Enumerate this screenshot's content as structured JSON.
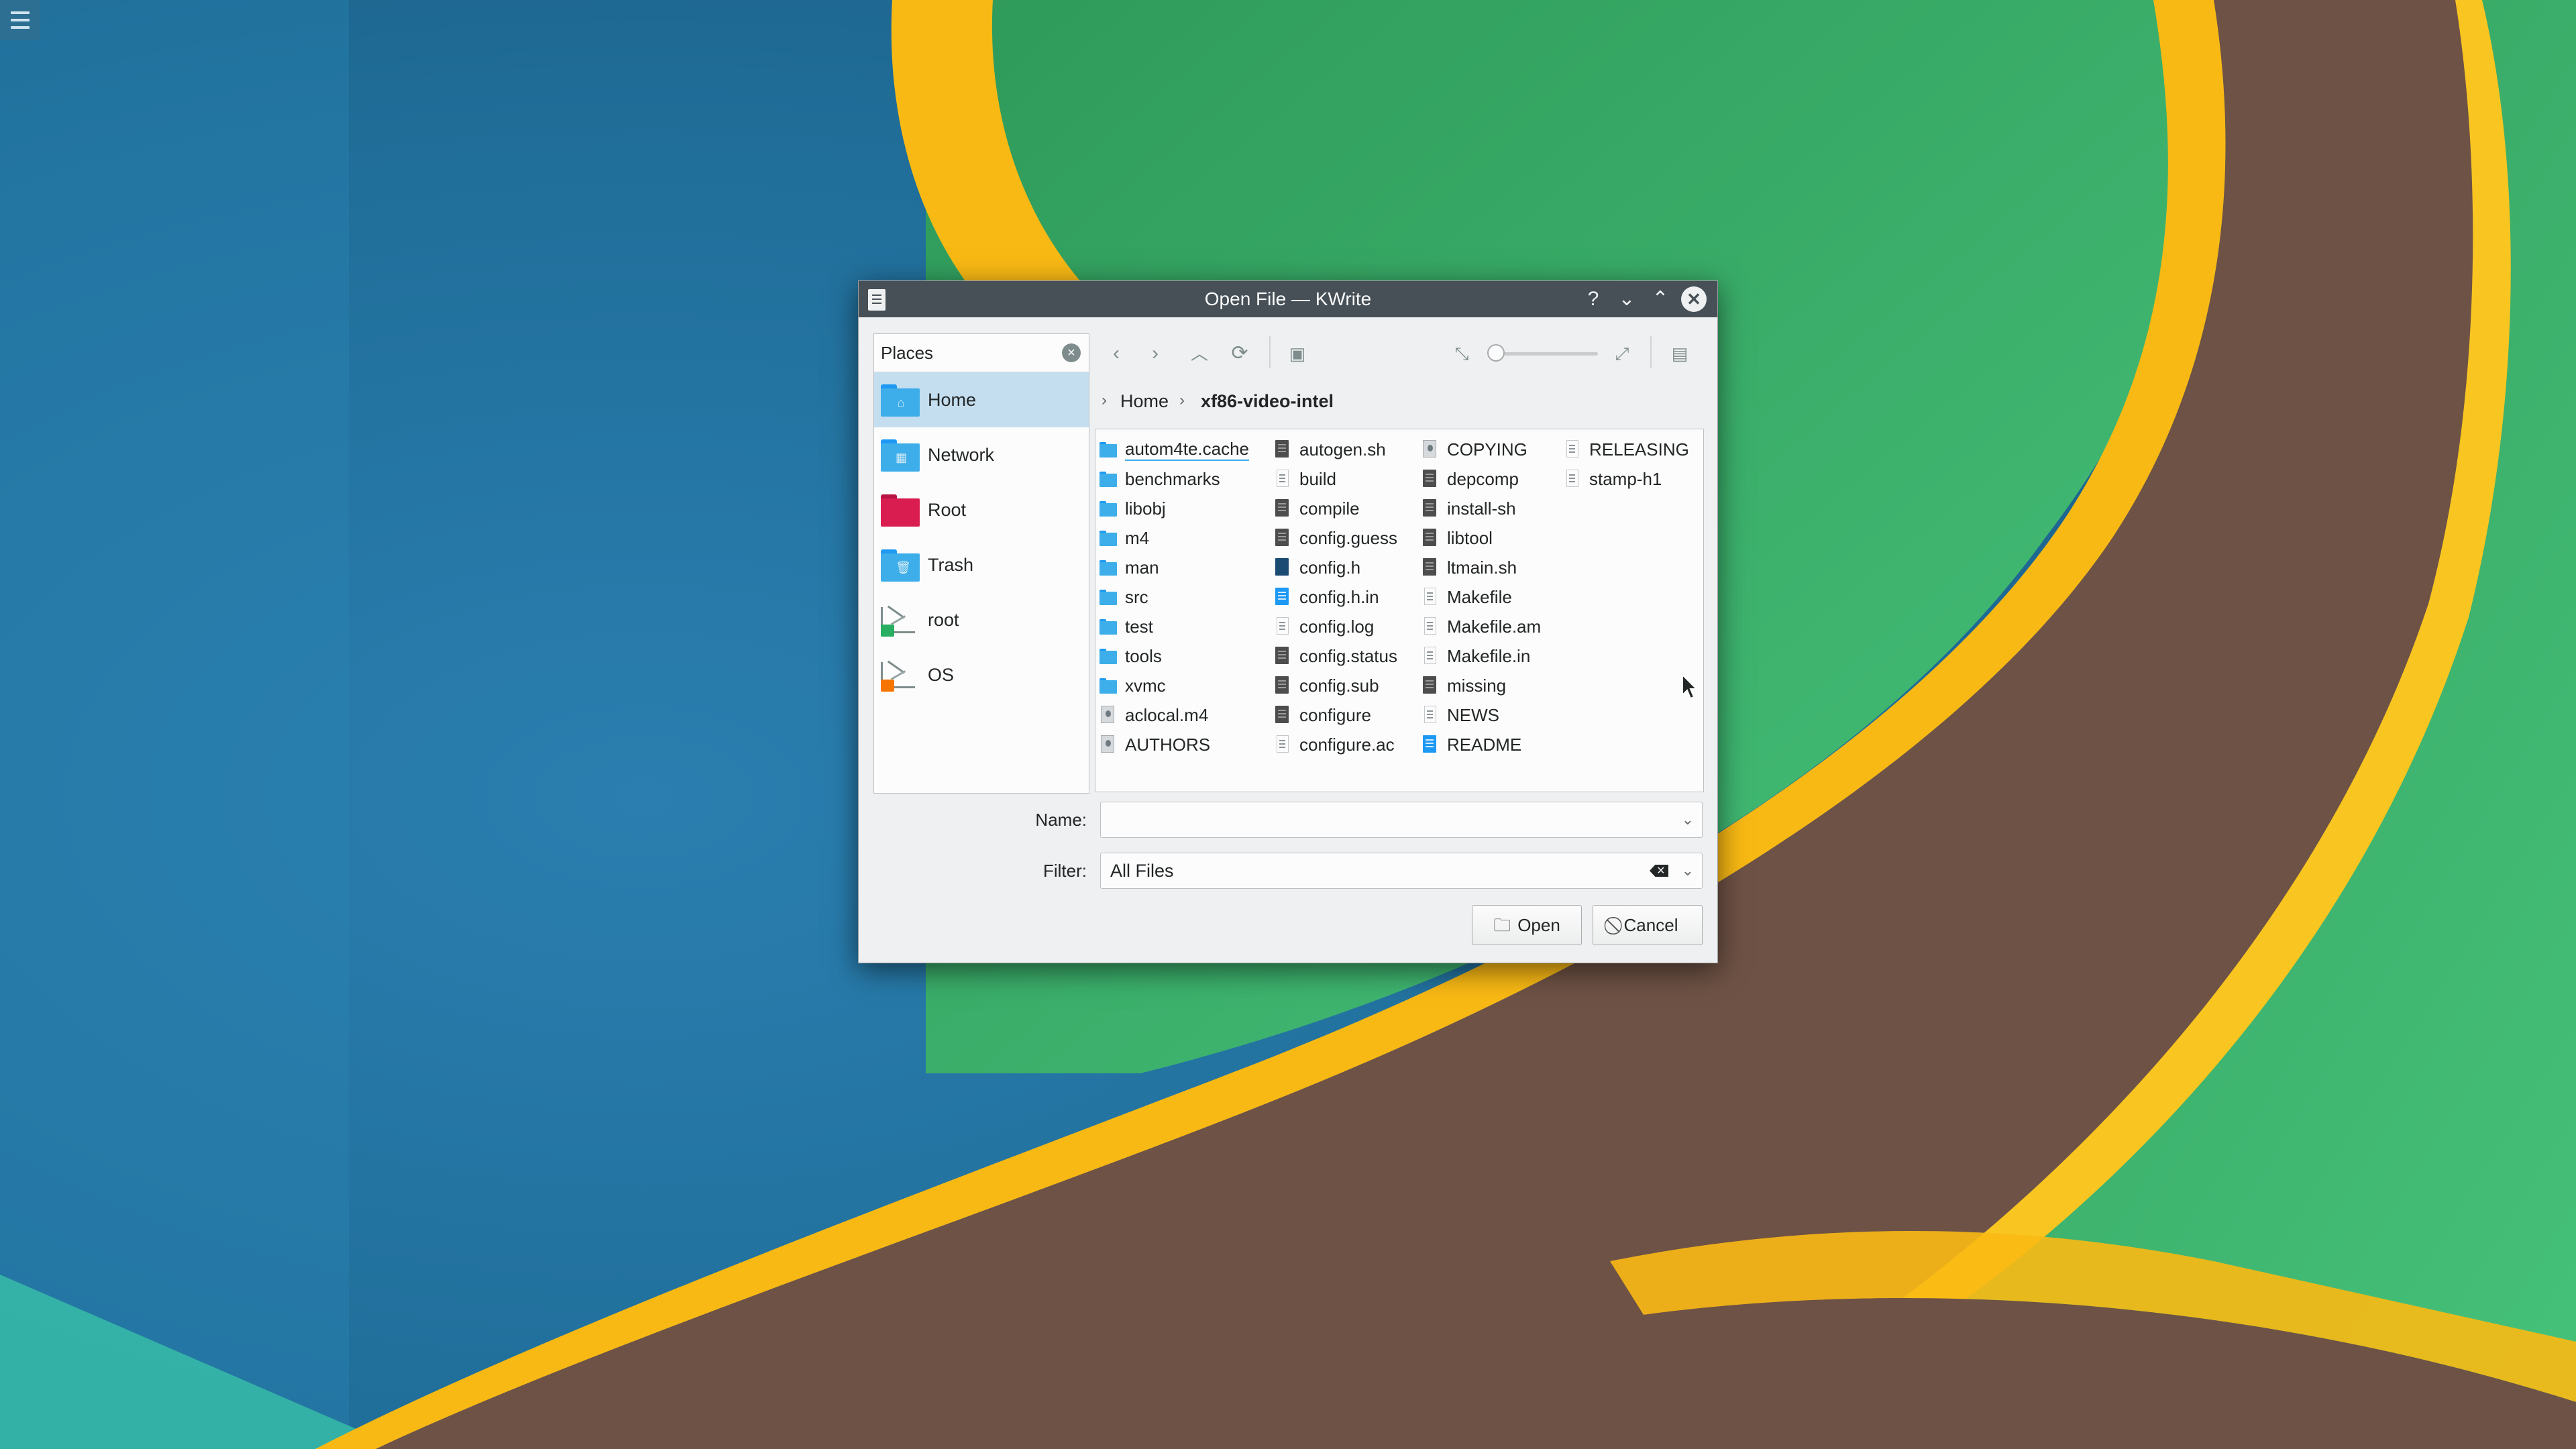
{
  "window": {
    "title": "Open File — KWrite",
    "help": "?",
    "minimize": "⌄",
    "maximize": "⌃",
    "close": "✕"
  },
  "places": {
    "header": "Places",
    "items": [
      {
        "label": "Home",
        "icon": "home-folder-icon",
        "color": "#3daee9",
        "selected": true
      },
      {
        "label": "Network",
        "icon": "network-folder-icon",
        "color": "#3daee9",
        "selected": false
      },
      {
        "label": "Root",
        "icon": "root-folder-icon",
        "color": "#da1d50",
        "selected": false
      },
      {
        "label": "Trash",
        "icon": "trash-folder-icon",
        "color": "#3daee9",
        "selected": false
      },
      {
        "label": "root",
        "icon": "drive-icon",
        "badge_color": "#27ae60",
        "selected": false
      },
      {
        "label": "OS",
        "icon": "drive-icon",
        "badge_color": "#f67400",
        "selected": false
      }
    ]
  },
  "toolbar": {
    "back": "back-arrow-icon",
    "forward": "forward-arrow-icon",
    "up": "up-arrow-icon",
    "reload": "reload-icon",
    "preview": "image-preview-icon",
    "zoom_out": "zoom-out-icon",
    "zoom_in": "zoom-in-icon",
    "zoom_level": 0,
    "options": "panel-options-icon"
  },
  "breadcrumb": {
    "parent": "Home",
    "current": "xf86-video-intel"
  },
  "files": {
    "columns": [
      [
        {
          "name": "autom4te.cache",
          "type": "folder",
          "focused": true
        },
        {
          "name": "benchmarks",
          "type": "folder"
        },
        {
          "name": "libobj",
          "type": "folder"
        },
        {
          "name": "m4",
          "type": "folder"
        },
        {
          "name": "man",
          "type": "folder"
        },
        {
          "name": "src",
          "type": "folder"
        },
        {
          "name": "test",
          "type": "folder"
        },
        {
          "name": "tools",
          "type": "folder"
        },
        {
          "name": "xvmc",
          "type": "folder"
        },
        {
          "name": "aclocal.m4",
          "type": "grey"
        },
        {
          "name": "AUTHORS",
          "type": "grey"
        }
      ],
      [
        {
          "name": "autogen.sh",
          "type": "dark"
        },
        {
          "name": "build",
          "type": "text"
        },
        {
          "name": "compile",
          "type": "dark"
        },
        {
          "name": "config.guess",
          "type": "dark"
        },
        {
          "name": "config.h",
          "type": "navy"
        },
        {
          "name": "config.h.in",
          "type": "blue"
        },
        {
          "name": "config.log",
          "type": "text"
        },
        {
          "name": "config.status",
          "type": "dark"
        },
        {
          "name": "config.sub",
          "type": "dark"
        },
        {
          "name": "configure",
          "type": "dark"
        },
        {
          "name": "configure.ac",
          "type": "text"
        }
      ],
      [
        {
          "name": "COPYING",
          "type": "grey"
        },
        {
          "name": "depcomp",
          "type": "dark"
        },
        {
          "name": "install-sh",
          "type": "dark"
        },
        {
          "name": "libtool",
          "type": "dark"
        },
        {
          "name": "ltmain.sh",
          "type": "dark"
        },
        {
          "name": "Makefile",
          "type": "text"
        },
        {
          "name": "Makefile.am",
          "type": "text"
        },
        {
          "name": "Makefile.in",
          "type": "text"
        },
        {
          "name": "missing",
          "type": "dark"
        },
        {
          "name": "NEWS",
          "type": "text"
        },
        {
          "name": "README",
          "type": "blue"
        }
      ],
      [
        {
          "name": "RELEASING",
          "type": "text"
        },
        {
          "name": "stamp-h1",
          "type": "text"
        }
      ]
    ]
  },
  "form": {
    "name_label": "Name:",
    "name_value": "",
    "filter_label": "Filter:",
    "filter_value": "All Files"
  },
  "buttons": {
    "open": "Open",
    "cancel": "Cancel"
  }
}
